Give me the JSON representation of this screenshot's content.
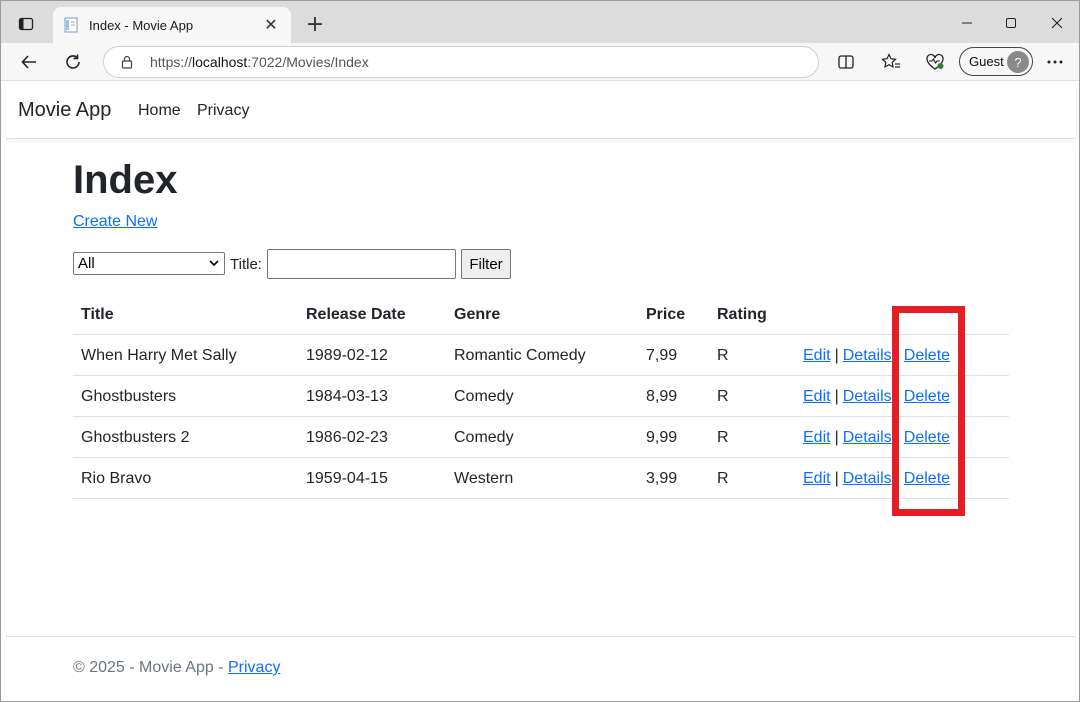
{
  "browser": {
    "tab_title": "Index - Movie App",
    "url_prefix": "https://",
    "url_host": "localhost",
    "url_rest": ":7022/Movies/Index",
    "profile_label": "Guest"
  },
  "navbar": {
    "brand": "Movie App",
    "links": [
      "Home",
      "Privacy"
    ]
  },
  "main": {
    "heading": "Index",
    "create_new": "Create New",
    "filter": {
      "genre_selected": "All",
      "title_label": "Title:",
      "title_value": "",
      "button_label": "Filter"
    },
    "table": {
      "headers": [
        "Title",
        "Release Date",
        "Genre",
        "Price",
        "Rating"
      ],
      "action_labels": {
        "edit": "Edit",
        "details": "Details",
        "delete": "Delete",
        "separator": "|"
      },
      "rows": [
        {
          "title": "When Harry Met Sally",
          "release_date": "1989-02-12",
          "genre": "Romantic Comedy",
          "price": "7,99",
          "rating": "R"
        },
        {
          "title": "Ghostbusters",
          "release_date": "1984-03-13",
          "genre": "Comedy",
          "price": "8,99",
          "rating": "R"
        },
        {
          "title": "Ghostbusters 2",
          "release_date": "1986-02-23",
          "genre": "Comedy",
          "price": "9,99",
          "rating": "R"
        },
        {
          "title": "Rio Bravo",
          "release_date": "1959-04-15",
          "genre": "Western",
          "price": "3,99",
          "rating": "R"
        }
      ]
    }
  },
  "footer": {
    "copyright": "© 2025 - Movie App - ",
    "privacy_link": "Privacy"
  },
  "colors": {
    "link": "#0d6efd",
    "highlight": "#e31e24"
  }
}
